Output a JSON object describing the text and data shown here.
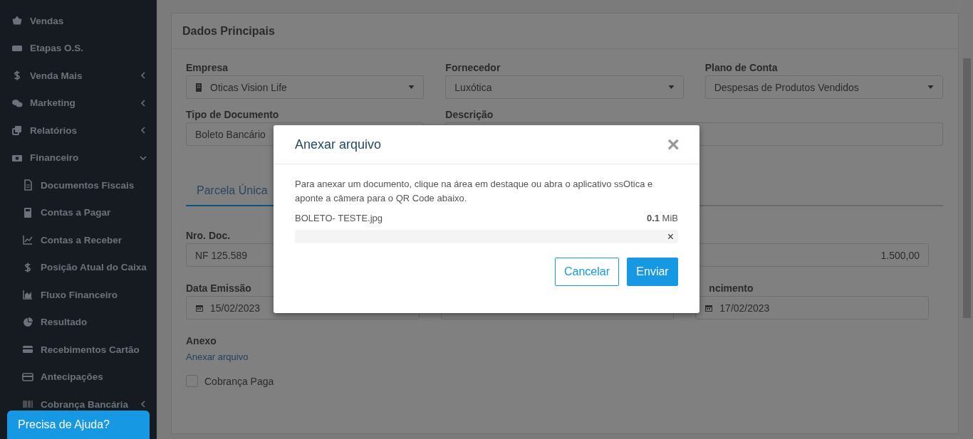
{
  "sidebar": {
    "items": [
      {
        "label": "Vendas"
      },
      {
        "label": "Etapas O.S."
      },
      {
        "label": "Venda Mais",
        "expanded": false
      },
      {
        "label": "Marketing",
        "expanded": false
      },
      {
        "label": "Relatórios",
        "expanded": false
      },
      {
        "label": "Financeiro",
        "expanded": true,
        "children": [
          {
            "label": "Documentos Fiscais"
          },
          {
            "label": "Contas a Pagar"
          },
          {
            "label": "Contas a Receber"
          },
          {
            "label": "Posição Atual do Caixa"
          },
          {
            "label": "Fluxo Financeiro"
          },
          {
            "label": "Resultado"
          },
          {
            "label": "Recebimentos Cartão"
          },
          {
            "label": "Antecipações"
          },
          {
            "label": "Cobrança Bancária",
            "expanded": false
          }
        ]
      }
    ]
  },
  "card": {
    "title": "Dados Principais",
    "rows": [
      [
        {
          "label": "Empresa",
          "kind": "select",
          "value": "Oticas Vision Life"
        },
        {
          "label": "Fornecedor",
          "kind": "select",
          "value": "Luxótica"
        },
        {
          "label": "Plano de Conta",
          "kind": "select",
          "value": "Despesas de Produtos Vendidos"
        }
      ],
      [
        {
          "label": "Tipo de Documento",
          "kind": "select",
          "value": "Boleto Bancário"
        },
        {
          "label": "Descrição",
          "kind": "wide-text"
        }
      ]
    ],
    "tabs": [
      {
        "label": "Parcela Única",
        "selected": true
      }
    ],
    "parcel_rows": [
      [
        {
          "label": "Nro. Doc.",
          "kind": "text",
          "value": "NF 125.589"
        },
        {
          "kind": "hidden"
        },
        {
          "kind": "amount",
          "value": "1.500,00"
        }
      ],
      [
        {
          "label": "Data Emissão",
          "kind": "date",
          "value": "15/02/2023"
        },
        {
          "kind": "date-covered"
        },
        {
          "label": "ncimento",
          "kind": "date",
          "value": "17/02/2023"
        }
      ]
    ],
    "attachment": {
      "label": "Anexo",
      "link": "Anexar arquivo"
    },
    "checkbox": {
      "label": "Cobrança Paga",
      "checked": false
    }
  },
  "modal": {
    "title": "Anexar arquivo",
    "close": "×",
    "text": "Para anexar um documento, clique na área em destaque ou abra o aplicativo ssOtica e aponte a câmera para o QR Code abaixo.",
    "file_name": "BOLETO- TESTE.jpg",
    "file_size": "**0.1** MiB",
    "progress": {
      "level": 0
    },
    "remove": "×",
    "buttons": [
      {
        "label": "Cancelar",
        "kind": "outline"
      },
      {
        "label": "Enviar",
        "kind": "primary"
      }
    ]
  },
  "help_button": "Precisa de Ajuda?"
}
